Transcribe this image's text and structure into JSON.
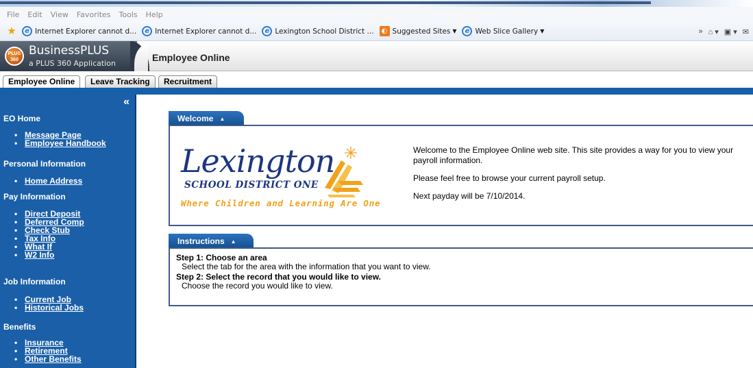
{
  "browser": {
    "menu": [
      "File",
      "Edit",
      "View",
      "Favorites",
      "Tools",
      "Help"
    ],
    "favorites": [
      {
        "label": "Internet Explorer cannot d...",
        "icon": "ie-icon",
        "dropdown": false
      },
      {
        "label": "Internet Explorer cannot d...",
        "icon": "ie-icon",
        "dropdown": false
      },
      {
        "label": "Lexington School District ...",
        "icon": "ie-icon",
        "dropdown": false
      },
      {
        "label": "Suggested Sites",
        "icon": "suggested-sites-icon",
        "dropdown": true
      },
      {
        "label": "Web Slice Gallery",
        "icon": "ie-icon",
        "dropdown": true
      }
    ],
    "chevron": "»"
  },
  "header": {
    "brand": "BusinessPLUS",
    "brand_sub": "a PLUS 360 Application",
    "badge": "PLUS 360",
    "app_title": "Employee Online"
  },
  "tabs": [
    {
      "label": "Employee Online",
      "active": true
    },
    {
      "label": "Leave Tracking",
      "active": false
    },
    {
      "label": "Recruitment",
      "active": false
    }
  ],
  "sidebar": {
    "collapse": "«",
    "sections": [
      {
        "title": "EO Home",
        "items": [
          "Message Page",
          "Employee Handbook"
        ]
      },
      {
        "title": "Personal Information",
        "items": [
          "Home Address"
        ]
      },
      {
        "title": "Pay Information",
        "items": [
          "Direct Deposit",
          "Deferred Comp",
          "Check Stub",
          "Tax Info",
          "What If",
          "W2 Info"
        ]
      },
      {
        "title": "Job Information",
        "items": [
          "Current Job",
          "Historical Jobs"
        ]
      },
      {
        "title": "Benefits",
        "items": [
          "Insurance",
          "Retirement",
          "Other Benefits"
        ]
      }
    ]
  },
  "welcome": {
    "tab": "Welcome",
    "logo_word": "Lexington",
    "logo_district": "SCHOOL DISTRICT ONE",
    "logo_tagline": "Where Children and Learning Are One",
    "lines": [
      "Welcome to the Employee Online web site. This site provides a way for you to view your payroll information.",
      "Please feel free to browse your current payroll setup.",
      "Next payday will be 7/10/2014."
    ]
  },
  "instructions": {
    "tab": "Instructions",
    "step1_title": "Step 1: Choose an area",
    "step1_desc": "Select the tab for the area with the information that you want to view.",
    "step2_title": "Step 2: Select the record that you would like to view.",
    "step2_desc": "Choose the record you would like to view."
  },
  "colors": {
    "sidebar": "#1a5fa8",
    "panel_tab": "#144f8f",
    "logo_blue": "#1d3680",
    "logo_gold": "#f1a21c"
  }
}
